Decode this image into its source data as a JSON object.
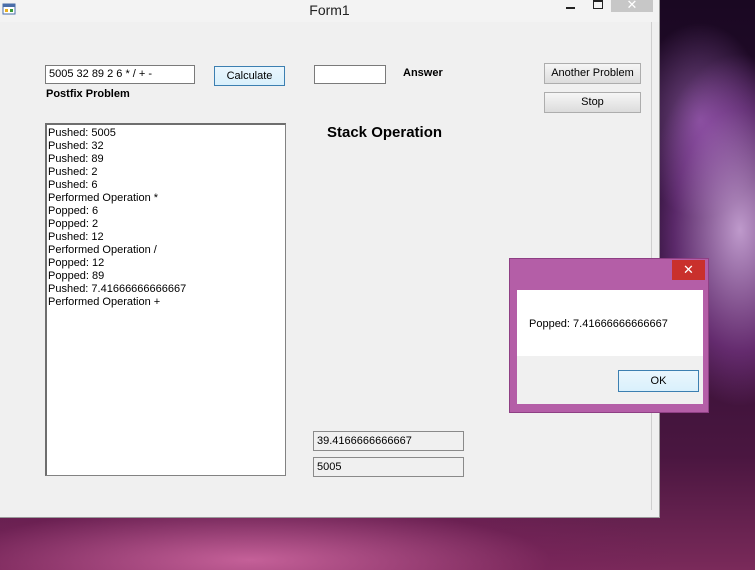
{
  "window": {
    "title": "Form1",
    "close_glyph": "✕",
    "app_icon": "winforms-app-icon"
  },
  "form": {
    "postfix_input_value": "5005 32 89 2 6 * / + -",
    "calculate_label": "Calculate",
    "answer_input_value": "",
    "answer_label": "Answer",
    "another_problem_label": "Another Problem",
    "stop_label": "Stop",
    "postfix_label": "Postfix Problem",
    "stack_operation_label": "Stack Operation",
    "log": [
      "Pushed: 5005",
      "Pushed: 32",
      "Pushed: 89",
      "Pushed: 2",
      "Pushed: 6",
      "Performed Operation *",
      "Popped: 6",
      "Popped: 2",
      "Pushed: 12",
      "Performed Operation /",
      "Popped: 12",
      "Popped: 89",
      "Pushed: 7.41666666666667",
      "Performed Operation +"
    ],
    "result_1": "39.4166666666667",
    "result_2": "5005"
  },
  "message_box": {
    "text": "Popped: 7.41666666666667",
    "ok_label": "OK",
    "close_glyph": "✕",
    "accent_color": "#b45ea7"
  }
}
